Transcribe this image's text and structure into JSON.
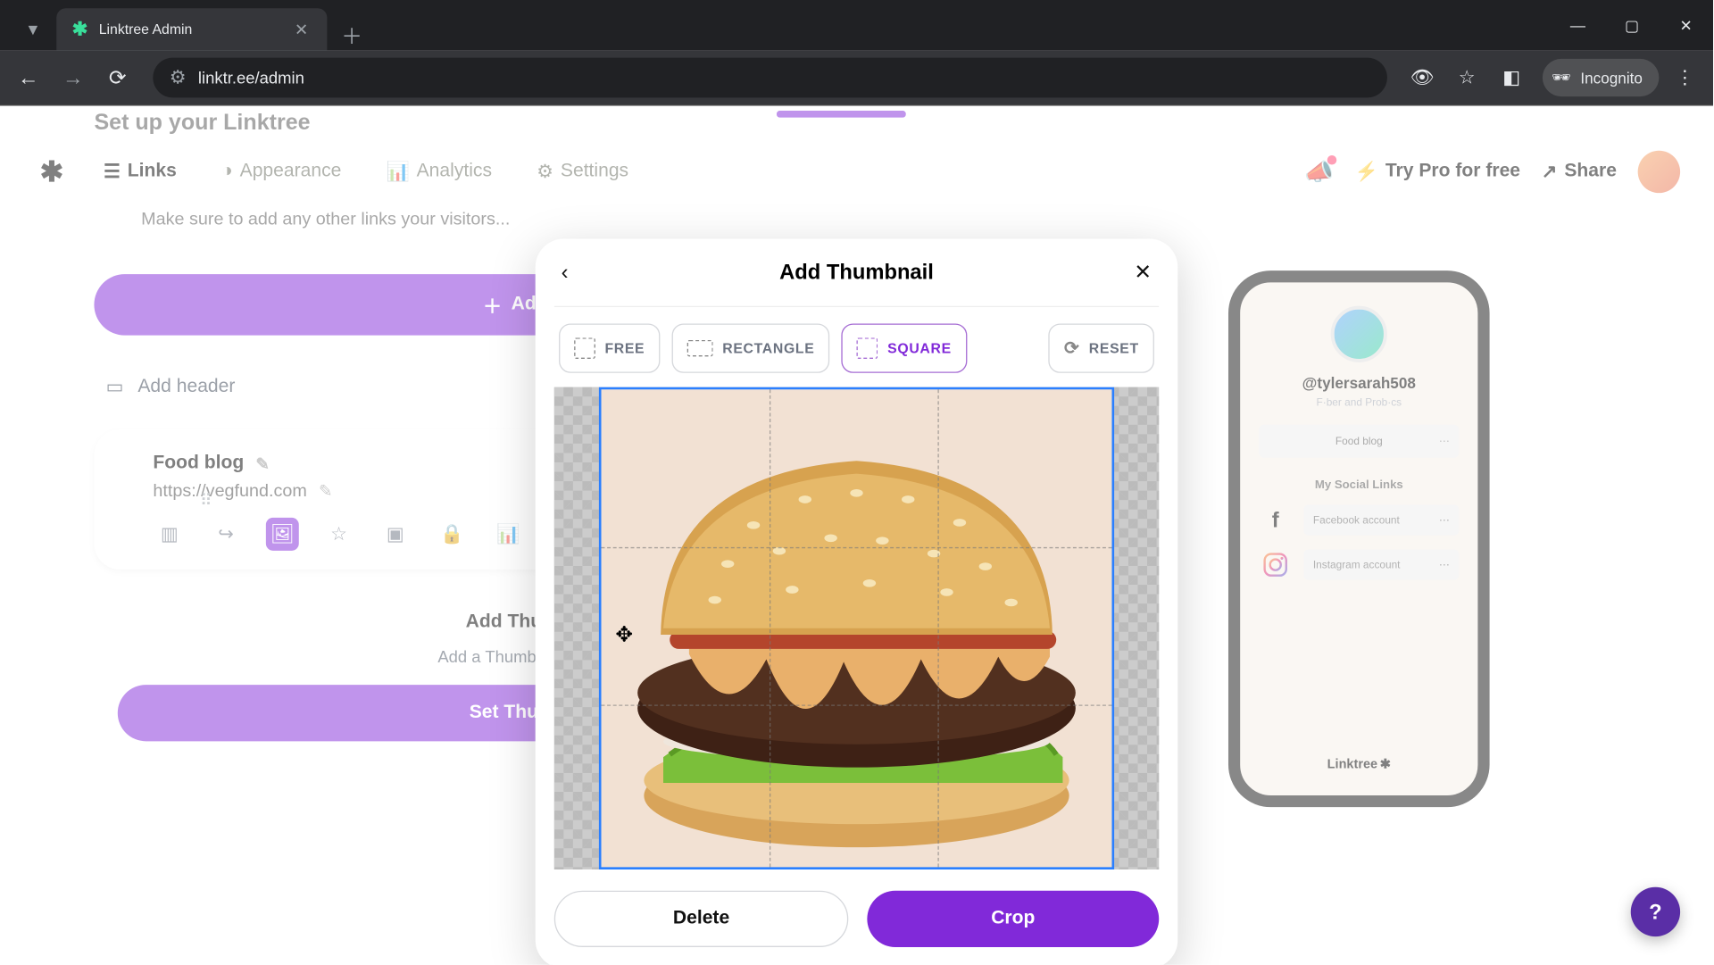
{
  "browser": {
    "tab_title": "Linktree Admin",
    "url_display": "linktr.ee/admin",
    "incognito_label": "Incognito"
  },
  "topbar": {
    "nav": {
      "links": "Links",
      "appearance": "Appearance",
      "analytics": "Analytics",
      "settings": "Settings"
    },
    "try_pro": "Try Pro for free",
    "share": "Share"
  },
  "setup": {
    "title": "Set up your Linktree",
    "hint": "Make sure to add any other links your visitors..."
  },
  "left": {
    "add_link": "Add link",
    "add_header": "Add header",
    "card": {
      "title": "Food blog",
      "url": "https://vegfund.com"
    },
    "panel": {
      "heading": "Add Thumbnail",
      "sub": "Add a Thumbnail or Icon...",
      "cta": "Set Thumbnail"
    }
  },
  "preview": {
    "username": "@tylersarah508",
    "subtitle": "F·ber and Prob·cs",
    "link1": "Food blog",
    "section": "My Social Links",
    "social": {
      "facebook": "Facebook account",
      "instagram": "Instagram account"
    },
    "footer": "Linktree"
  },
  "modal": {
    "title": "Add Thumbnail",
    "crop": {
      "free": "FREE",
      "rectangle": "RECTANGLE",
      "square": "SQUARE",
      "reset": "RESET"
    },
    "actions": {
      "delete": "Delete",
      "crop_btn": "Crop"
    }
  },
  "help": "?"
}
